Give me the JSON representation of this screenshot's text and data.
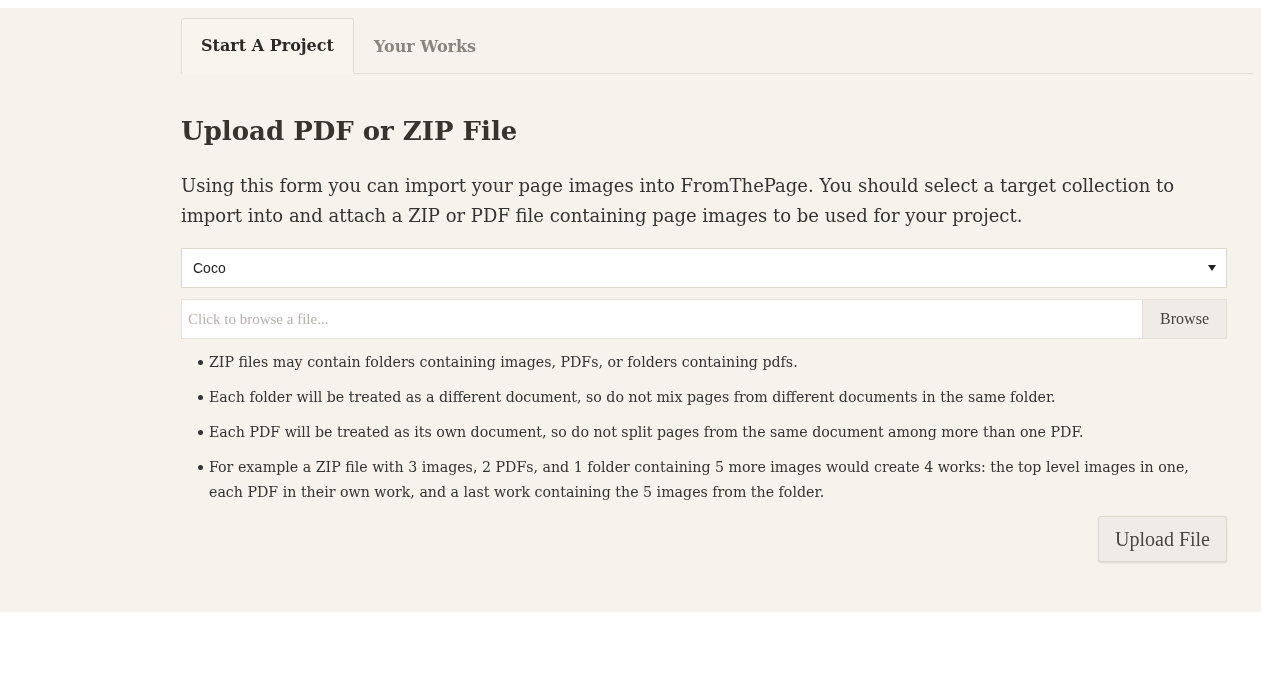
{
  "tabs": [
    {
      "label": "Start A Project",
      "selected": true
    },
    {
      "label": "Your Works",
      "selected": false
    }
  ],
  "heading": "Upload PDF or ZIP File",
  "intro": "Using this form you can import your page images into FromThePage. You should select a target collection to import into and attach a ZIP or PDF file containing page images to be used for your project.",
  "collection_select": {
    "value": "Coco"
  },
  "file_field": {
    "placeholder": "Click to browse a file...",
    "button": "Browse"
  },
  "notes": [
    "ZIP files may contain folders containing images, PDFs, or folders containing pdfs.",
    "Each folder will be treated as a different document, so do not mix pages from different documents in the same folder.",
    "Each PDF will be treated as its own document, so do not split pages from the same document among more than one PDF.",
    "For example a ZIP file with 3 images, 2 PDFs, and 1 folder containing 5 more images would create 4 works: the top level images in one, each PDF in their own work, and a last work containing the 5 images from the folder."
  ],
  "submit": "Upload File"
}
